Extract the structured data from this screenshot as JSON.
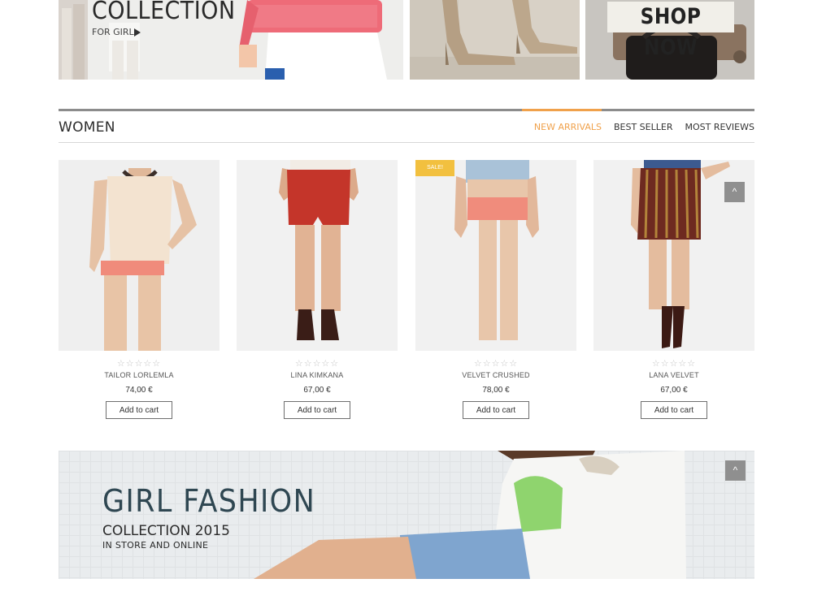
{
  "top_banners": {
    "collection": {
      "title": "COLLECTION",
      "subtitle": "FOR GIRL"
    },
    "shop": {
      "label": "SHOP NOW"
    }
  },
  "section": {
    "title": "WOMEN",
    "tabs": [
      {
        "label": "NEW ARRIVALS",
        "active": true
      },
      {
        "label": "BEST SELLER",
        "active": false
      },
      {
        "label": "MOST REVIEWS",
        "active": false
      }
    ]
  },
  "products": [
    {
      "name": "TAILOR LORLEMLA",
      "price": "74,00 €",
      "rating": "☆☆☆☆☆",
      "button": "Add to cart"
    },
    {
      "name": "LINA KIMKANA",
      "price": "67,00 €",
      "rating": "☆☆☆☆☆",
      "button": "Add to cart"
    },
    {
      "name": "VELVET CRUSHED",
      "price": "78,00 €",
      "rating": "☆☆☆☆☆",
      "button": "Add to cart",
      "badge": "SALE!"
    },
    {
      "name": "LANA VELVET",
      "price": "67,00 €",
      "rating": "☆☆☆☆☆",
      "button": "Add to cart"
    }
  ],
  "back_to_top_icon": "chevron-up-icon",
  "promo_banner": {
    "title": "GIRL FASHION",
    "subtitle": "COLLECTION 2015",
    "tagline": "IN STORE AND ONLINE"
  },
  "colors": {
    "accent": "#f0a14b",
    "badge": "#f2c03f"
  }
}
